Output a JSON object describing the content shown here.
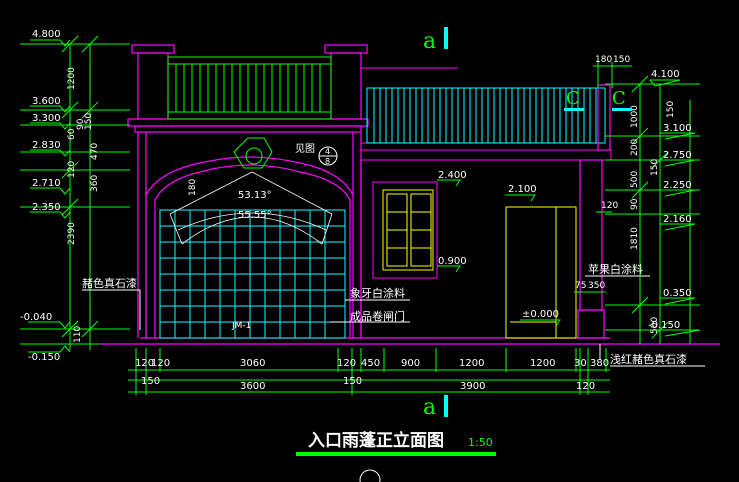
{
  "title": "入口雨蓬正立面图",
  "scale": "1:50",
  "section_mark": "a",
  "detail_mark": "C",
  "callout": {
    "label": "见图",
    "top": "4",
    "bottom": "8"
  },
  "left_elevations": [
    "4.800",
    "3.600",
    "3.300",
    "2.830",
    "2.710",
    "2.350",
    "-0.040",
    "-0.150"
  ],
  "left_dims": [
    "1200",
    "90",
    "60",
    "150",
    "470",
    "120",
    "360",
    "2390",
    "110"
  ],
  "right_elevations": [
    "4.100",
    "3.100",
    "2.750",
    "2.250",
    "2.160",
    "0.350",
    "-0.150"
  ],
  "right_dims": [
    "1000",
    "200",
    "150",
    "500",
    "90",
    "1810",
    "500",
    "150"
  ],
  "top_dims": [
    "180",
    "150"
  ],
  "window_levels": [
    "2.400",
    "0.900"
  ],
  "door_levels": [
    "2.100",
    "±0.000"
  ],
  "post_dims": [
    "120",
    "75",
    "350"
  ],
  "angles": [
    "53.13°",
    "55.55°"
  ],
  "small_dim": "180",
  "door_tag": "JM-1",
  "labels": {
    "stone": "赭色真石漆",
    "ivory": "象牙白涂料",
    "shutter": "成品卷闸门",
    "apple_white": "苹果白涂料",
    "base_stone": "浅红赭色真石漆"
  },
  "dim_row1": [
    "120",
    "120",
    "3060",
    "120",
    "450",
    "900",
    "1200",
    "1200",
    "30",
    "380"
  ],
  "dim_row2": [
    "150",
    "150"
  ],
  "dim_row3": [
    "3600",
    "3900",
    "120"
  ],
  "colors": {
    "bg": "#000000",
    "wall": "#ff00ff",
    "rail": "#00ffff",
    "dim": "#00ff00",
    "text": "#ffffff",
    "window": "#ffff00",
    "door": "#ffff00",
    "mark": "#00ff00"
  }
}
